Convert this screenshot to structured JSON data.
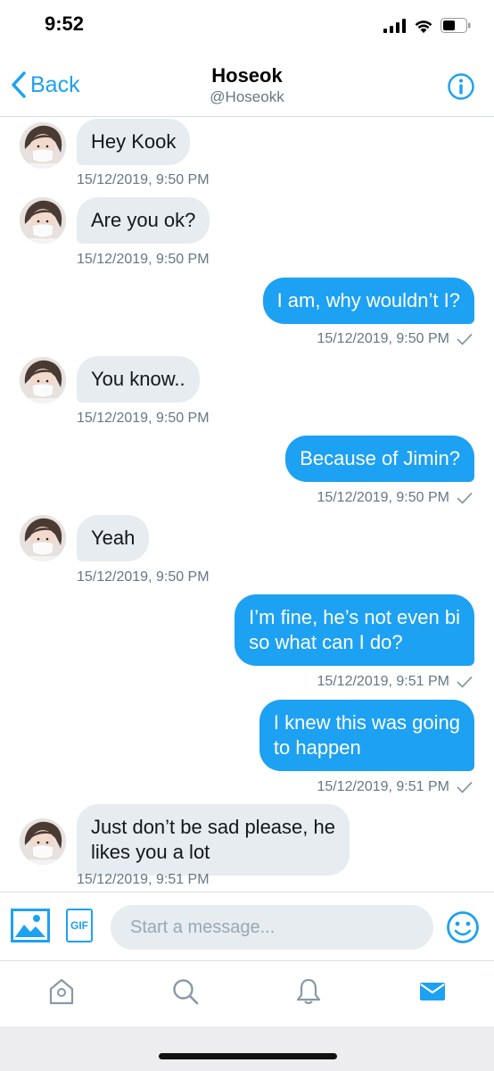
{
  "status_bar": {
    "time": "9:52"
  },
  "header": {
    "back_label": "Back",
    "name": "Hoseok",
    "handle": "@Hoseokk"
  },
  "messages": [
    {
      "side": "in",
      "text": "Hey Kook",
      "timestamp": "15/12/2019, 9:50 PM"
    },
    {
      "side": "in",
      "text": "Are you ok?",
      "timestamp": "15/12/2019, 9:50 PM"
    },
    {
      "side": "out",
      "text": "I am, why wouldn’t I?",
      "timestamp": "15/12/2019, 9:50 PM"
    },
    {
      "side": "in",
      "text": "You know..",
      "timestamp": "15/12/2019, 9:50 PM"
    },
    {
      "side": "out",
      "text": "Because of Jimin?",
      "timestamp": "15/12/2019, 9:50 PM"
    },
    {
      "side": "in",
      "text": "Yeah",
      "timestamp": "15/12/2019, 9:50 PM"
    },
    {
      "side": "out",
      "text": "I’m fine, he’s not even bi\nso what can I do?",
      "timestamp": "15/12/2019, 9:51 PM"
    },
    {
      "side": "out",
      "text": "I knew this was going\nto happen",
      "timestamp": "15/12/2019, 9:51 PM"
    },
    {
      "side": "in",
      "text": "Just don’t be sad please, he\nlikes you a lot",
      "timestamp": "15/12/2019, 9:51 PM"
    }
  ],
  "composer": {
    "gif_label": "GIF",
    "placeholder": "Start a message..."
  },
  "tabs": [
    {
      "icon": "home-icon",
      "active": false
    },
    {
      "icon": "search-icon",
      "active": false
    },
    {
      "icon": "bell-icon",
      "active": false
    },
    {
      "icon": "mail-icon",
      "active": true
    }
  ],
  "colors": {
    "accent": "#1da1f2",
    "bubble_in": "#e6ecf0",
    "meta_text": "#657786"
  }
}
